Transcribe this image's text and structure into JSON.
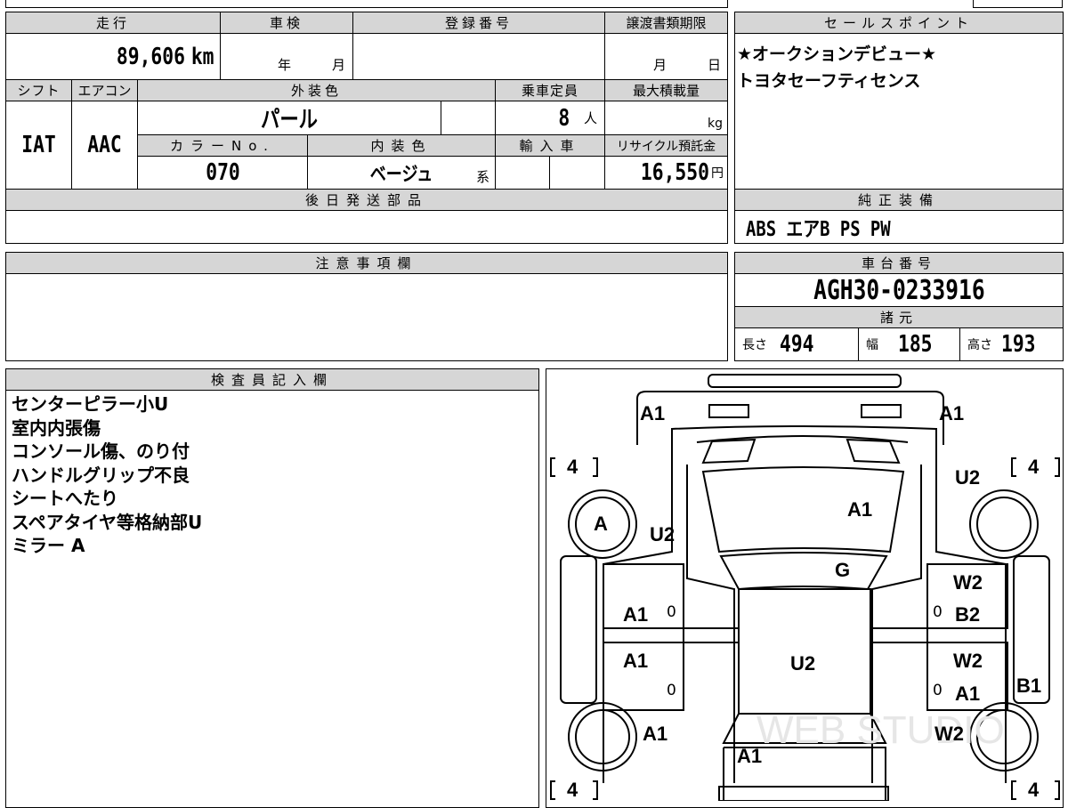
{
  "mileage": {
    "label": "走行",
    "value": "89,606",
    "unit": "km"
  },
  "inspection": {
    "label": "車検",
    "year_unit": "年",
    "month_unit": "月"
  },
  "registration": {
    "label": "登録番号",
    "value": ""
  },
  "transfer_deadline": {
    "label": "譲渡書類期限",
    "month_unit": "月",
    "day_unit": "日"
  },
  "shift": {
    "label": "シフト",
    "value": "IAT"
  },
  "aircon": {
    "label": "エアコン",
    "value": "AAC"
  },
  "exterior_color": {
    "label": "外装色",
    "value": "パール"
  },
  "capacity": {
    "label": "乗車定員",
    "value": "8",
    "unit": "人"
  },
  "max_load": {
    "label": "最大積載量",
    "value": "",
    "unit": "kg"
  },
  "color_no": {
    "label": "カラーNo.",
    "value": "070"
  },
  "interior_color": {
    "label": "内装色",
    "value": "ベージュ",
    "suffix": "系"
  },
  "import_car": {
    "label": "輸入車",
    "value": ""
  },
  "recycle_fee": {
    "label": "リサイクル預託金",
    "value": "16,550",
    "unit": "円"
  },
  "later_parts": {
    "label": "後日発送部品",
    "value": ""
  },
  "sales_points": {
    "label": "セールスポイント",
    "lines": [
      "★オークションデビュー★",
      "トヨタセーフティセンス"
    ]
  },
  "genuine_equipment": {
    "label": "純正装備",
    "value": "ABS エアB PS PW"
  },
  "caution": {
    "label": "注意事項欄",
    "value": ""
  },
  "chassis": {
    "label": "車台番号",
    "value": "AGH30-0233916"
  },
  "specs": {
    "label": "諸元",
    "length_label": "長さ",
    "length": "494",
    "width_label": "幅",
    "width": "185",
    "height_label": "高さ",
    "height": "193"
  },
  "inspector": {
    "label": "検査員記入欄",
    "notes": [
      "センターピラー小U",
      "室内内張傷",
      "コンソール傷、のり付",
      "ハンドルグリップ不良",
      "シートへたり",
      "スペアタイヤ等格納部U",
      "ミラー A"
    ]
  },
  "diagram": {
    "front_left": "A1",
    "front_right": "A1",
    "hood": "A1",
    "windshield": "G",
    "left_front_fender": "U2",
    "right_front_fender": "U2",
    "left_front_door": "A1",
    "left_rear_door": "A1",
    "right_front_door_top": "W2",
    "right_front_door": "B2",
    "right_rear_door_top": "W2",
    "right_rear_door": "A1",
    "right_sill": "B1",
    "roof": "U2",
    "left_rear_fender": "A1",
    "right_rear_fender": "W2",
    "rear": "A1",
    "front_left_tire_mark": "A",
    "tire_fl": "4",
    "tire_fr": "4",
    "tire_rl": "4",
    "tire_rr": "4",
    "door_zero": "0",
    "watermark": "WEB STUDIO"
  }
}
